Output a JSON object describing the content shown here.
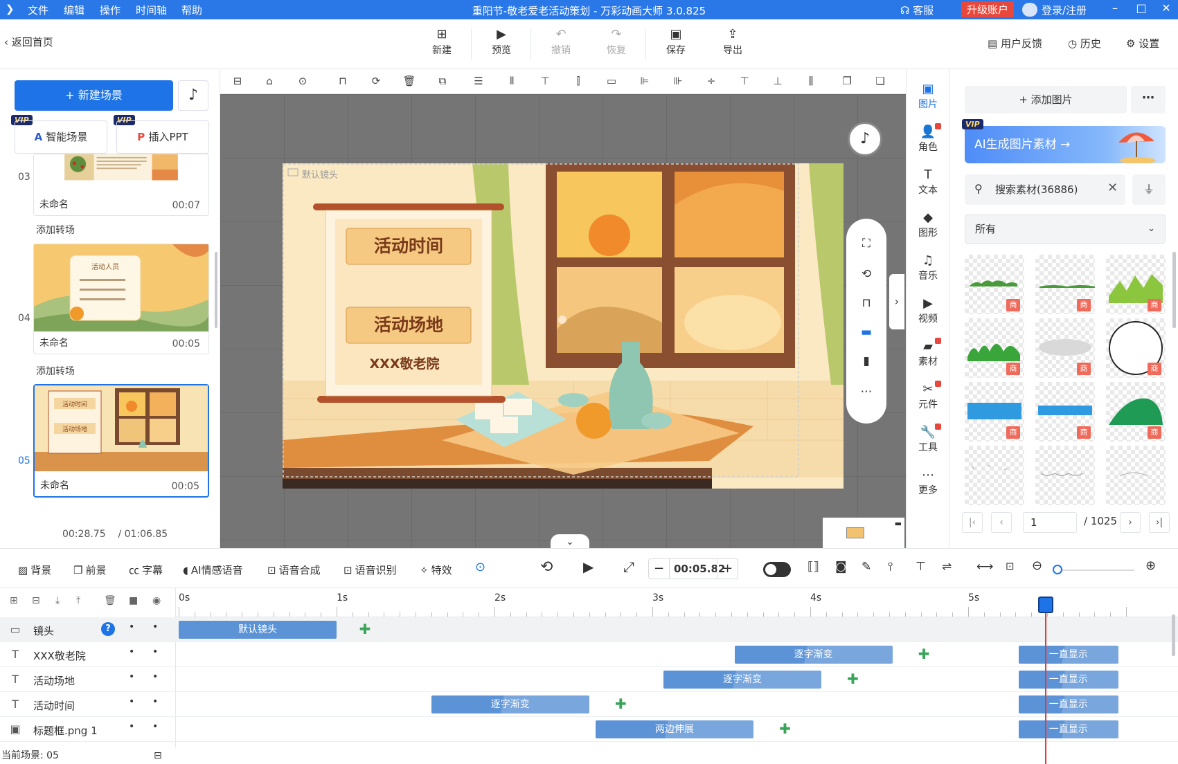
{
  "titlebar": {
    "app_icon": "play-logo",
    "menus": [
      "文件",
      "编辑",
      "操作",
      "时间轴",
      "帮助"
    ],
    "title": "重阳节-敬老爱老活动策划 - 万彩动画大师 3.0.825",
    "service": "客服",
    "upgrade": "升级账户",
    "login": "登录/注册",
    "colors": {
      "bar": "#2a78e8",
      "upgrade": "#e8473c"
    }
  },
  "toolbar": {
    "back": "返回首页",
    "tools": [
      {
        "label": "新建",
        "icon": "plus-square-icon"
      },
      {
        "label": "预览",
        "icon": "play-icon"
      },
      {
        "label": "撤销",
        "icon": "undo-icon"
      },
      {
        "label": "恢复",
        "icon": "redo-icon"
      },
      {
        "label": "保存",
        "icon": "save-icon"
      },
      {
        "label": "导出",
        "icon": "export-icon"
      }
    ],
    "right": [
      "用户反馈",
      "历史",
      "设置"
    ]
  },
  "left": {
    "new_scene": "新建场景",
    "smart_scene": "智能场景",
    "insert_ppt": "插入PPT",
    "vip": "VIP",
    "scenes": [
      {
        "num": "03",
        "name": "未命名",
        "duration": "00:07"
      },
      {
        "num": "04",
        "name": "未命名",
        "duration": "00:05"
      },
      {
        "num": "05",
        "name": "未命名",
        "duration": "00:05"
      }
    ],
    "add_transition": "添加转场",
    "time_current": "00:28.75",
    "time_total": "/ 01:06.85",
    "thumb_text": {
      "t4_title": "活动人员",
      "t5_a": "活动时间",
      "t5_b": "活动场地"
    }
  },
  "canvas": {
    "camera_label": "默认镜头",
    "board_title_1": "活动时间",
    "board_title_2": "活动场地",
    "board_venue": "XXX敬老院"
  },
  "rail": {
    "items": [
      {
        "label": "图片",
        "icon": "image-icon",
        "selected": true,
        "dot": false
      },
      {
        "label": "角色",
        "icon": "person-icon",
        "selected": false,
        "dot": true
      },
      {
        "label": "文本",
        "icon": "text-icon",
        "selected": false,
        "dot": false
      },
      {
        "label": "图形",
        "icon": "shape-icon",
        "selected": false,
        "dot": false
      },
      {
        "label": "音乐",
        "icon": "music-icon",
        "selected": false,
        "dot": false
      },
      {
        "label": "视频",
        "icon": "video-icon",
        "selected": false,
        "dot": false
      },
      {
        "label": "素材",
        "icon": "folder-icon",
        "selected": false,
        "dot": true
      },
      {
        "label": "元件",
        "icon": "component-icon",
        "selected": false,
        "dot": true
      },
      {
        "label": "工具",
        "icon": "wrench-icon",
        "selected": false,
        "dot": true
      },
      {
        "label": "更多",
        "icon": "more-icon",
        "selected": false,
        "dot": false
      }
    ]
  },
  "materials": {
    "add_image": "添加图片",
    "ai_banner": "AI生成图片素材",
    "search_placeholder": "搜索素材(36886)",
    "category": "所有",
    "badge": "商",
    "page": "1",
    "page_total": "/ 1025"
  },
  "timeline_bar": {
    "buttons": [
      "背景",
      "前景",
      "字幕",
      "AI情感语音",
      "语音合成",
      "语音识别",
      "特效"
    ],
    "time": "00:05.82",
    "minus": "−",
    "plus": "+"
  },
  "timeline": {
    "ruler": [
      "0s",
      "1s",
      "2s",
      "3s",
      "4s",
      "5s"
    ],
    "tracks": [
      {
        "name": "镜头",
        "icon": "camera-icon",
        "cam": true
      },
      {
        "name": "XXX敬老院",
        "icon": "T",
        "cam": false
      },
      {
        "name": "活动场地",
        "icon": "T",
        "cam": false
      },
      {
        "name": "活动时间",
        "icon": "T",
        "cam": false
      },
      {
        "name": "标题框.png 1",
        "icon": "image-icon",
        "cam": false
      }
    ],
    "clips": {
      "camera": "默认镜头",
      "fade_word": "逐字渐变",
      "stretch": "两边伸展",
      "always": "一直显示"
    },
    "status": "当前场景: 05"
  }
}
